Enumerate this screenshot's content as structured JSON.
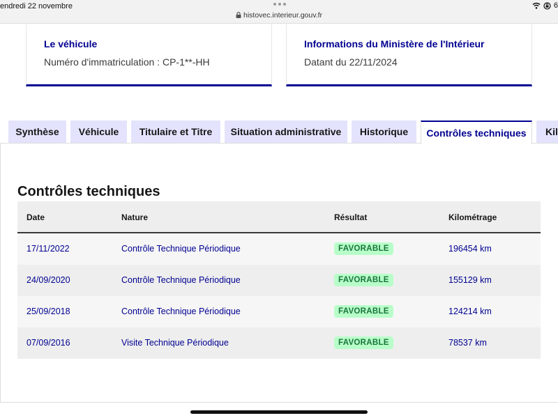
{
  "status_bar": {
    "time": "endredi 22 novembre",
    "url": "histovec.interieur.gouv.fr",
    "battery": "6"
  },
  "cards": {
    "vehicle": {
      "title": "Le véhicule",
      "label": "Numéro d'immatriculation : ",
      "plate": "CP-1**-HH"
    },
    "ministry": {
      "title": "Informations du Ministère de l'Intérieur",
      "text": "Datant du 22/11/2024"
    }
  },
  "tabs": [
    {
      "label": "Synthèse",
      "active": false
    },
    {
      "label": "Véhicule",
      "active": false
    },
    {
      "label": "Titulaire et Titre",
      "active": false
    },
    {
      "label": "Situation administrative",
      "active": false
    },
    {
      "label": "Historique",
      "active": false
    },
    {
      "label": "Contrôles techniques",
      "active": true
    },
    {
      "label": "Kilo",
      "active": false
    }
  ],
  "section": {
    "title": "Contrôles techniques"
  },
  "table": {
    "headers": [
      "Date",
      "Nature",
      "Résultat",
      "Kilométrage"
    ],
    "rows": [
      {
        "date": "17/11/2022",
        "nature": "Contrôle Technique Périodique",
        "result": "FAVORABLE",
        "km": "196454 km"
      },
      {
        "date": "24/09/2020",
        "nature": "Contrôle Technique Périodique",
        "result": "FAVORABLE",
        "km": "155129 km"
      },
      {
        "date": "25/09/2018",
        "nature": "Contrôle Technique Périodique",
        "result": "FAVORABLE",
        "km": "124214 km"
      },
      {
        "date": "07/09/2016",
        "nature": "Visite Technique Périodique",
        "result": "FAVORABLE",
        "km": "78537 km"
      }
    ]
  },
  "colors": {
    "brand_blue": "#000091",
    "tab_bg": "#e3e3fd",
    "badge_bg": "#b8fec9",
    "badge_text": "#18753c"
  }
}
